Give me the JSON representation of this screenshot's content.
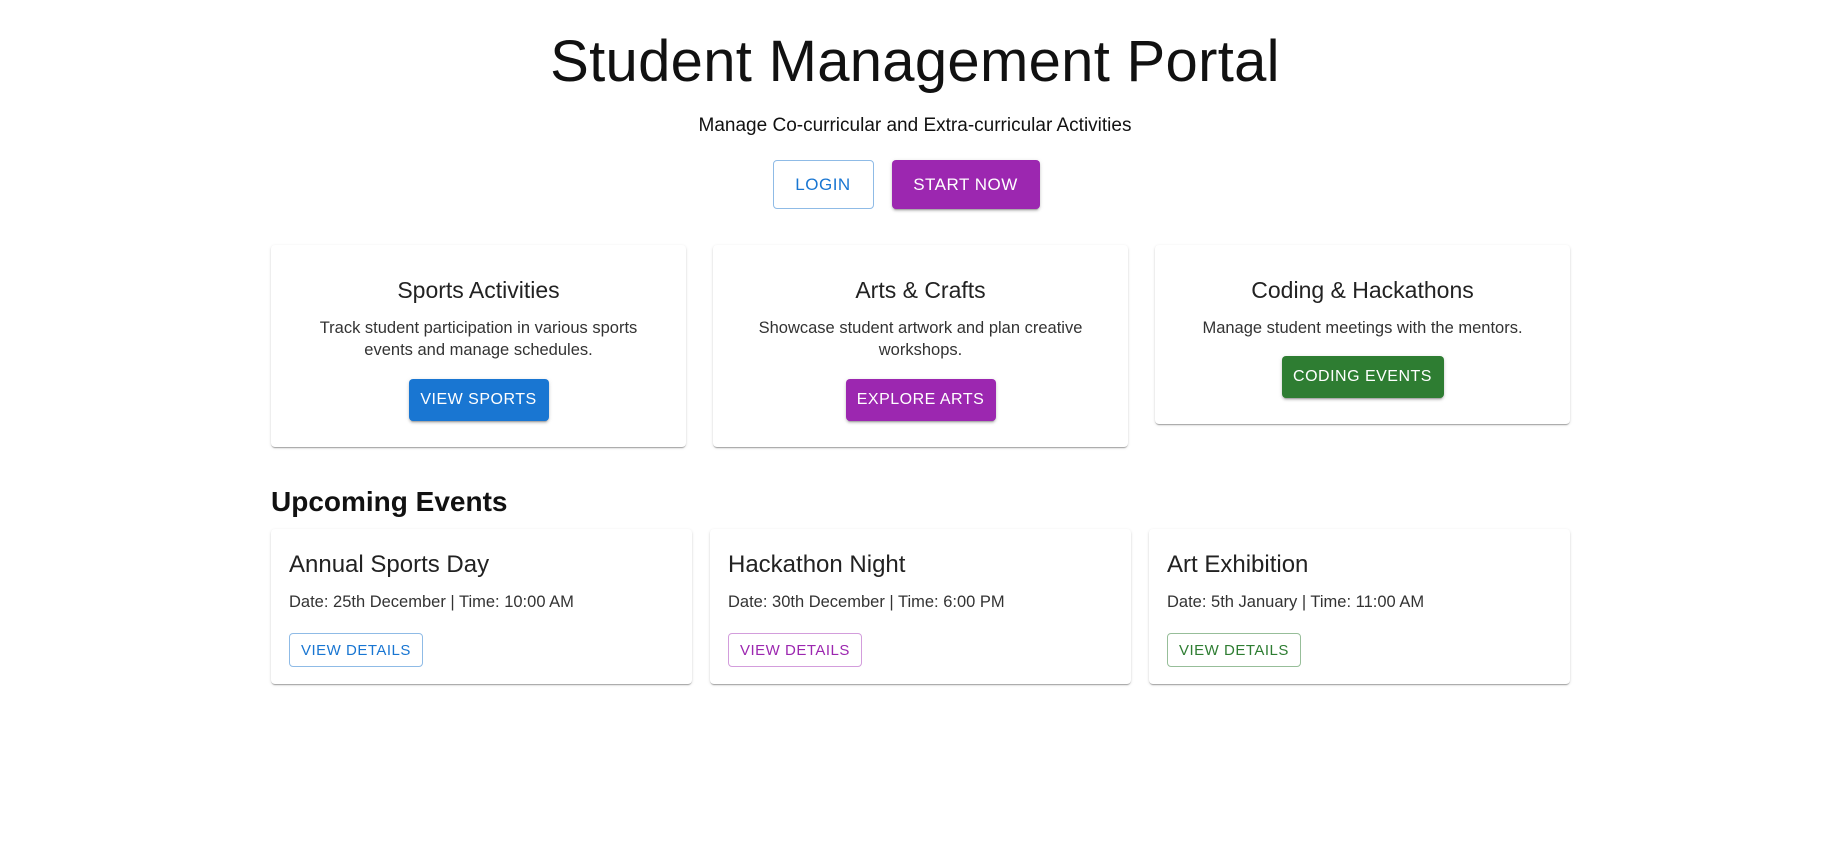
{
  "hero": {
    "title": "Student Management Portal",
    "subtitle": "Manage Co-curricular and Extra-curricular Activities",
    "login_label": "LOGIN",
    "start_label": "START NOW"
  },
  "features": [
    {
      "title": "Sports Activities",
      "description": "Track student participation in various sports events and manage schedules.",
      "button_label": "VIEW SPORTS",
      "color": "#1976d2"
    },
    {
      "title": "Arts & Crafts",
      "description": "Showcase student artwork and plan creative workshops.",
      "button_label": "EXPLORE ARTS",
      "color": "#9c27b0"
    },
    {
      "title": "Coding & Hackathons",
      "description": "Manage student meetings with the mentors.",
      "button_label": "CODING EVENTS",
      "color": "#2e7d32"
    }
  ],
  "events_section": {
    "heading": "Upcoming Events",
    "events": [
      {
        "title": "Annual Sports Day",
        "meta": "Date: 25th December | Time: 10:00 AM",
        "button_label": "VIEW DETAILS",
        "color": "#1976d2"
      },
      {
        "title": "Hackathon Night",
        "meta": "Date: 30th December | Time: 6:00 PM",
        "button_label": "VIEW DETAILS",
        "color": "#9c27b0"
      },
      {
        "title": "Art Exhibition",
        "meta": "Date: 5th January | Time: 11:00 AM",
        "button_label": "VIEW DETAILS",
        "color": "#2e7d32"
      }
    ]
  }
}
